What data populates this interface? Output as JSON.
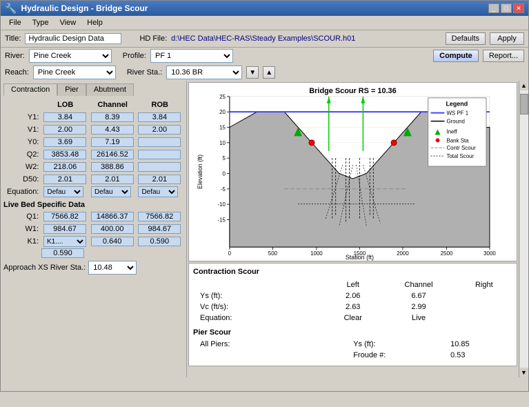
{
  "window": {
    "title": "Hydraulic Design - Bridge Scour",
    "icon": "hydraulic-icon"
  },
  "menu": {
    "items": [
      "File",
      "Type",
      "View",
      "Help"
    ]
  },
  "toolbar": {
    "title_label": "Title:",
    "title_value": "Hydraulic Design Data",
    "hd_file_label": "HD File:",
    "hd_file_value": "d:\\HEC Data\\HEC-RAS\\Steady Examples\\SCOUR.h01",
    "defaults_label": "Defaults",
    "apply_label": "Apply",
    "compute_label": "Compute",
    "report_label": "Report..."
  },
  "row2": {
    "river_label": "River:",
    "river_value": "Pine Creek",
    "profile_label": "Profile:",
    "profile_value": "PF 1"
  },
  "row3": {
    "reach_label": "Reach:",
    "reach_value": "Pine Creek",
    "river_sta_label": "River Sta.:",
    "river_sta_value": "10.36  BR"
  },
  "tabs": [
    "Contraction",
    "Pier",
    "Abutment"
  ],
  "active_tab": "Contraction",
  "column_headers": [
    "",
    "LOB",
    "Channel",
    "ROB"
  ],
  "data_rows": [
    {
      "label": "Y1:",
      "lob": "3.84",
      "channel": "8.39",
      "rob": "3.84"
    },
    {
      "label": "V1:",
      "lob": "2.00",
      "channel": "4.43",
      "rob": "2.00"
    },
    {
      "label": "Y0:",
      "lob": "3.69",
      "channel": "7.19",
      "rob": ""
    },
    {
      "label": "Q2:",
      "lob": "3853.48",
      "channel": "26146.52",
      "rob": ""
    },
    {
      "label": "W2:",
      "lob": "218.06",
      "channel": "388.86",
      "rob": ""
    },
    {
      "label": "D50:",
      "lob": "2.01",
      "channel": "2.01",
      "rob": "2.01"
    }
  ],
  "equation_row": {
    "label": "Equation:",
    "lob": "Defau",
    "channel": "Defau",
    "rob": "Defau"
  },
  "live_bed": {
    "header": "Live Bed Specific Data",
    "rows": [
      {
        "label": "Q1:",
        "lob": "7566.82",
        "channel": "14866.37",
        "rob": "7566.82"
      },
      {
        "label": "W1:",
        "lob": "984.67",
        "channel": "400.00",
        "rob": "984.67"
      },
      {
        "label": "K1:",
        "lob": "K1....",
        "channel": "0.640",
        "rob": "0.590"
      }
    ],
    "k1_lob": "0.590"
  },
  "approach": {
    "label": "Approach XS River Sta.:",
    "value": "10.48"
  },
  "chart": {
    "title": "Bridge Scour RS = 10.36",
    "x_label": "Station (ft)",
    "y_label": "Elevation (ft)",
    "x_min": 0,
    "x_max": 3000,
    "y_min": -15,
    "y_max": 25,
    "x_ticks": [
      0,
      500,
      1000,
      1500,
      2000,
      2500,
      3000
    ],
    "y_ticks": [
      -15,
      -10,
      -5,
      0,
      5,
      10,
      15,
      20,
      25
    ]
  },
  "legend": {
    "title": "Legend",
    "items": [
      {
        "label": "WS PF 1",
        "color": "#4444ff",
        "style": "solid"
      },
      {
        "label": "Ground",
        "color": "#000000",
        "style": "solid"
      },
      {
        "label": "Ineff",
        "color": "#00aa00",
        "style": "triangle"
      },
      {
        "label": "Bank Sta",
        "color": "#ff0000",
        "style": "dot"
      },
      {
        "label": "Contr Scour",
        "color": "#888888",
        "style": "dashed"
      },
      {
        "label": "Total Scour",
        "color": "#000000",
        "style": "dotted"
      }
    ]
  },
  "bottom_panel": {
    "contraction_scour_header": "Contraction Scour",
    "col_left": "Left",
    "col_channel": "Channel",
    "col_right": "Right",
    "ys_label": "Ys (ft):",
    "ys_left": "2.06",
    "ys_channel": "6.67",
    "vc_label": "Vc (ft/s):",
    "vc_left": "2.63",
    "vc_channel": "2.99",
    "equation_label": "Equation:",
    "eq_left": "Clear",
    "eq_channel": "Live",
    "pier_scour_header": "Pier Scour",
    "all_piers_label": "All Piers:",
    "ys_piers_label": "Ys (ft):",
    "ys_piers": "10.85",
    "froude_label": "Froude #:",
    "froude_value": "0.53"
  }
}
